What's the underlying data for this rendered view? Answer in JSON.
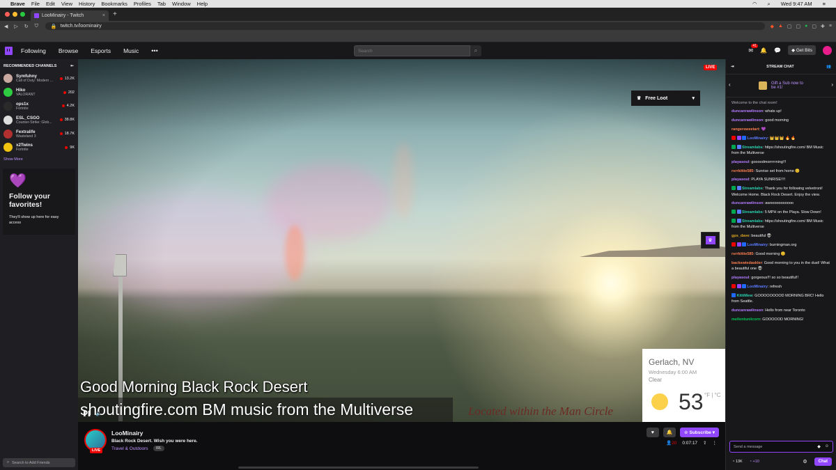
{
  "menubar": {
    "app": "Brave",
    "items": [
      "File",
      "Edit",
      "View",
      "History",
      "Bookmarks",
      "Profiles",
      "Tab",
      "Window",
      "Help"
    ],
    "clock": "Wed 9:47 AM"
  },
  "browser": {
    "tab_title": "LooMinairy - Twitch",
    "new_tab": "+",
    "url": "twitch.tv/loominairy"
  },
  "twitch": {
    "nav": {
      "following": "Following",
      "browse": "Browse",
      "esports": "Esports",
      "music": "Music",
      "more": "•••",
      "search_placeholder": "Search",
      "notif_count": "41",
      "get_bits": "Get Bits"
    },
    "sidebar": {
      "heading": "RECOMMENDED CHANNELS",
      "channels": [
        {
          "name": "Symfuhny",
          "game": "Call of Duty: Modern ...",
          "viewers": "13.2K",
          "color": "#c9a8a0"
        },
        {
          "name": "Hiko",
          "game": "VALORANT",
          "viewers": "202",
          "color": "#2ecc40"
        },
        {
          "name": "ops1x",
          "game": "Fortnite",
          "viewers": "4.2K",
          "color": "#2a2a2a"
        },
        {
          "name": "ESL_CSGO",
          "game": "Counter-Strike: Glob...",
          "viewers": "38.8K",
          "color": "#dddddd"
        },
        {
          "name": "Fextralife",
          "game": "Wasteland 3",
          "viewers": "18.7K",
          "color": "#b03030"
        },
        {
          "name": "x2Twins",
          "game": "Fortnite",
          "viewers": "9K",
          "color": "#f1c40f"
        }
      ],
      "show_more": "Show More",
      "favorites_title": "Follow your favorites!",
      "favorites_text": "They'll show up here for easy access",
      "friends_placeholder": "Search to Add Friends"
    },
    "player": {
      "live": "LIVE",
      "free_loot": "Free Loot",
      "caption_line1": "Good Morning Black Rock Desert",
      "caption_line2": "shoutingfire.com BM music from the Multiverse",
      "caption_line3": "Located within the Man Circle",
      "weather": {
        "city": "Gerlach, NV",
        "date": "Wednesday 6:00 AM",
        "condition": "Clear",
        "temp": "53",
        "unit": "°F | °C"
      }
    },
    "channel": {
      "name": "LooMinairy",
      "live": "LIVE",
      "title": "Black Rock Desert. Wish you were here.",
      "category": "Travel & Outdoors",
      "tag": "IRL",
      "subscribe": "Subscribe",
      "viewers": "20",
      "uptime": "0:07:17"
    },
    "chat": {
      "header": "STREAM CHAT",
      "gift_line1": "Gift a Sub now to",
      "gift_line2": "be #1!",
      "welcome": "Welcome to the chat room!",
      "messages": [
        {
          "user": "duncanrawlinson",
          "color": "#b57cff",
          "text": ": whats up!",
          "badges": []
        },
        {
          "user": "duncanrawlinson",
          "color": "#b57cff",
          "text": ": good morning",
          "badges": []
        },
        {
          "user": "rangersweetart",
          "color": "#ff7f50",
          "text": ": 💜",
          "badges": []
        },
        {
          "user": "LooMinairy",
          "color": "#5c7cff",
          "text": ": 👑👑👑 🔥 🔥",
          "badges": [
            "#eb0400",
            "#9147ff",
            "#1f69ff"
          ]
        },
        {
          "user": "Streamlabs",
          "color": "#2bd1b0",
          "text": ": https://shoutingfire.com/ BM Music from the Multiverse",
          "badges": [
            "#00a650",
            "#5c7cff"
          ]
        },
        {
          "user": "playasoul",
          "color": "#b57cff",
          "text": ": goooodmorrrrrning!!!",
          "badges": []
        },
        {
          "user": "rsrrkittie585",
          "color": "#ff7f50",
          "text": ": Sunrise set from home 😊",
          "badges": []
        },
        {
          "user": "playasoul",
          "color": "#b57cff",
          "text": ": PLAYA SUNRISE!!!!",
          "badges": []
        },
        {
          "user": "Streamlabs",
          "color": "#2bd1b0",
          "text": ": Thank you for following velvetroni! Welcome Home. Black Rock Desert. Enjoy the view.",
          "badges": [
            "#00a650",
            "#5c7cff"
          ]
        },
        {
          "user": "duncanrawlinson",
          "color": "#b57cff",
          "text": ": awooooooooooo",
          "badges": []
        },
        {
          "user": "Streamlabs",
          "color": "#2bd1b0",
          "text": ": 5 MPH on the Playa. Slow Down!",
          "badges": [
            "#00a650",
            "#5c7cff"
          ]
        },
        {
          "user": "Streamlabs",
          "color": "#2bd1b0",
          "text": ": https://shoutingfire.com/ BM Music from the Multiverse",
          "badges": [
            "#00a650",
            "#5c7cff"
          ]
        },
        {
          "user": "gps_dave",
          "color": "#daa520",
          "text": ": beautiful 👽",
          "badges": []
        },
        {
          "user": "LooMinairy",
          "color": "#5c7cff",
          "text": ": burningman.org",
          "badges": [
            "#eb0400",
            "#9147ff",
            "#1f69ff"
          ]
        },
        {
          "user": "rsrrkittie585",
          "color": "#ff7f50",
          "text": ": Good morning 😊",
          "badges": []
        },
        {
          "user": "backswiedaskler",
          "color": "#ff7f50",
          "text": ": Good morning to you in the dust! What a beautiful one 👽",
          "badges": []
        },
        {
          "user": "playasoul",
          "color": "#b57cff",
          "text": ": gorgeous!!! so so beautiful!!",
          "badges": []
        },
        {
          "user": "LooMinairy",
          "color": "#5c7cff",
          "text": ": refresh",
          "badges": [
            "#eb0400",
            "#9147ff",
            "#1f69ff"
          ]
        },
        {
          "user": "KittiMew",
          "color": "#2bd1b0",
          "text": ": GOOOOOOOOD MORNING BRC! Hello from Seattle.",
          "badges": [
            "#1f69ff"
          ]
        },
        {
          "user": "duncanrawlinson",
          "color": "#b57cff",
          "text": ": Hello from near Toronto",
          "badges": []
        },
        {
          "user": "mellontuniicorn",
          "color": "#00c853",
          "text": ": GOOOOOD MORNING!",
          "badges": []
        }
      ],
      "input_placeholder": "Send a message",
      "points": "13K",
      "bonus": "+10",
      "chat_button": "Chat"
    }
  }
}
